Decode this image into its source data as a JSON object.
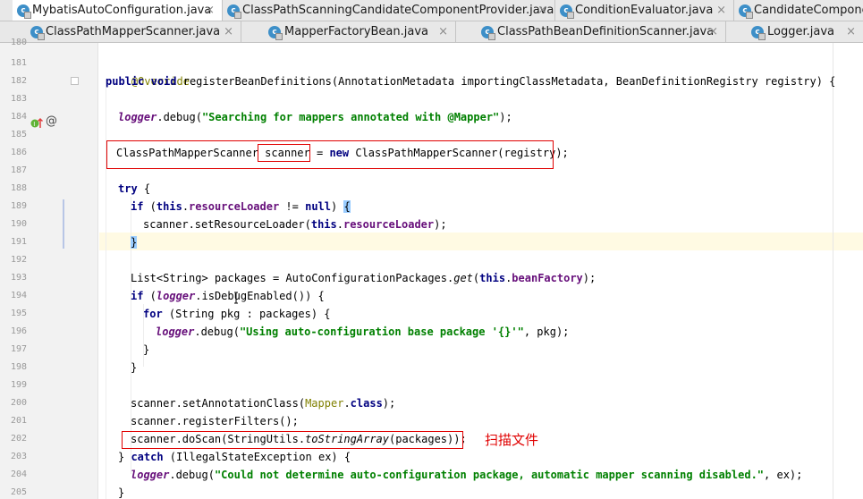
{
  "tabs_row1": [
    {
      "label": "MybatisAutoConfiguration.java",
      "active": true
    },
    {
      "label": "ClassPathScanningCandidateComponentProvider.java",
      "active": false
    },
    {
      "label": "ConditionEvaluator.java",
      "active": false
    },
    {
      "label": "CandidateComponentsIndexLoader.java",
      "active": false
    }
  ],
  "tabs_row2": [
    {
      "label": "ClassPathMapperScanner.java"
    },
    {
      "label": "MapperFactoryBean.java"
    },
    {
      "label": "ClassPathBeanDefinitionScanner.java"
    },
    {
      "label": "Logger.java"
    }
  ],
  "close_glyph": "×",
  "tab_icon_letter": "c",
  "line_numbers": [
    "180",
    "181",
    "182",
    "183",
    "184",
    "185",
    "186",
    "187",
    "188",
    "189",
    "190",
    "191",
    "192",
    "193",
    "194",
    "195",
    "196",
    "197",
    "198",
    "199",
    "200",
    "201",
    "202",
    "203",
    "204",
    "205"
  ],
  "code": {
    "l181": {
      "ann": "@Override"
    },
    "l182": {
      "kw1": "public",
      "kw2": "void",
      "rest": " registerBeanDefinitions(AnnotationMetadata importingClassMetadata, BeanDefinitionRegistry registry) {"
    },
    "l184": {
      "logger": "logger",
      "mid": ".debug(",
      "str": "\"Searching for mappers annotated with @Mapper\"",
      "end": ");"
    },
    "l186": {
      "a": "ClassPathMapperScanner ",
      "var": "scanner",
      "b": " = ",
      "kw": "new",
      "c": " ClassPathMapperScanner(registry);"
    },
    "l188": {
      "kw": "try",
      "rest": " {"
    },
    "l189": {
      "kw1": "if",
      "a": " (",
      "kw2": "this",
      "b": ".",
      "fld": "resourceLoader",
      "c": " != ",
      "kw3": "null",
      "d": ") ",
      "brace": "{"
    },
    "l190": {
      "a": "scanner.setResourceLoader(",
      "kw": "this",
      "b": ".",
      "fld": "resourceLoader",
      "c": ");"
    },
    "l191": {
      "brace": "}"
    },
    "l193": {
      "a": "List<String> packages = AutoConfigurationPackages.",
      "it": "get",
      "b": "(",
      "kw": "this",
      "c": ".",
      "fld": "beanFactory",
      "d": ");"
    },
    "l194": {
      "kw": "if",
      "a": " (",
      "logger": "logger",
      "b": ".isDebugEnabled()) {"
    },
    "l195": {
      "kw": "for",
      "rest": " (String pkg : packages) {"
    },
    "l196": {
      "logger": "logger",
      "mid": ".debug(",
      "str": "\"Using auto-configuration base package '{}'\"",
      "end": ", pkg);"
    },
    "l197": {
      "text": "}"
    },
    "l198": {
      "text": "}"
    },
    "l200": {
      "a": "scanner.setAnnotationClass(",
      "ann": "Mapper",
      "b": ".",
      "kw": "class",
      "c": ");"
    },
    "l201": {
      "text": "scanner.registerFilters();"
    },
    "l202": {
      "a": "scanner.doScan(StringUtils.",
      "it": "toStringArray",
      "b": "(packages));"
    },
    "l203": {
      "a": "} ",
      "kw": "catch",
      "b": " (IllegalStateException ex) {"
    },
    "l204": {
      "logger": "logger",
      "mid": ".debug(",
      "str": "\"Could not determine auto-configuration package, automatic mapper scanning disabled.\"",
      "end": ", ex);"
    },
    "l205": {
      "text": "}"
    }
  },
  "annotation_note": "扫描文件",
  "colors": {
    "keyword": "#000080",
    "field": "#660e7a",
    "string": "#008000",
    "annotation": "#808000",
    "highlight_box": "#e00000",
    "caret_line": "#fffae3"
  }
}
